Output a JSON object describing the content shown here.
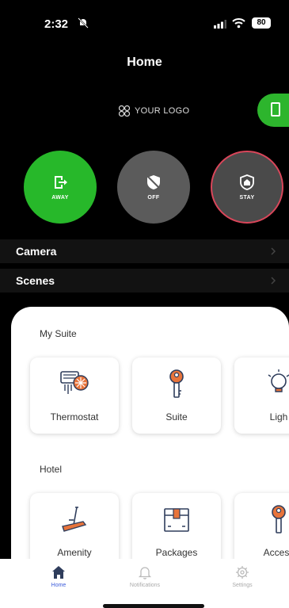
{
  "status_bar": {
    "time": "2:32",
    "battery": "80"
  },
  "header": {
    "title": "Home"
  },
  "logo": {
    "text": "YOUR LOGO"
  },
  "modes": [
    {
      "label": "AWAY",
      "icon": "exit-door-icon",
      "color": "#27b82a"
    },
    {
      "label": "OFF",
      "icon": "shield-off-icon",
      "color": "#5b5b5b"
    },
    {
      "label": "STAY",
      "icon": "home-shield-icon",
      "color": "#4a4a4a",
      "ring": "#d9465a"
    }
  ],
  "rows": [
    {
      "label": "Camera"
    },
    {
      "label": "Scenes"
    }
  ],
  "sections": {
    "my_suite": {
      "title": "My Suite",
      "tiles": [
        {
          "label": "Thermostat",
          "icon": "thermostat-icon"
        },
        {
          "label": "Suite",
          "icon": "key-icon"
        },
        {
          "label": "Ligh",
          "icon": "light-bulb-icon"
        }
      ]
    },
    "hotel": {
      "title": "Hotel",
      "tiles": [
        {
          "label": "Amenity",
          "icon": "treadmill-icon"
        },
        {
          "label": "Packages",
          "icon": "package-icon"
        },
        {
          "label": "Access",
          "icon": "key-icon"
        }
      ]
    }
  },
  "tab_bar": {
    "items": [
      {
        "label": "Home",
        "icon": "home-icon",
        "active": true
      },
      {
        "label": "Notifications",
        "icon": "bell-icon",
        "active": false
      },
      {
        "label": "Settings",
        "icon": "gear-icon",
        "active": false
      }
    ]
  },
  "colors": {
    "accent_green": "#27b82a",
    "tab_active": "#3b5bdb",
    "stay_ring": "#d9465a",
    "icon_orange": "#e8743b",
    "icon_navy": "#2f3d5c"
  }
}
